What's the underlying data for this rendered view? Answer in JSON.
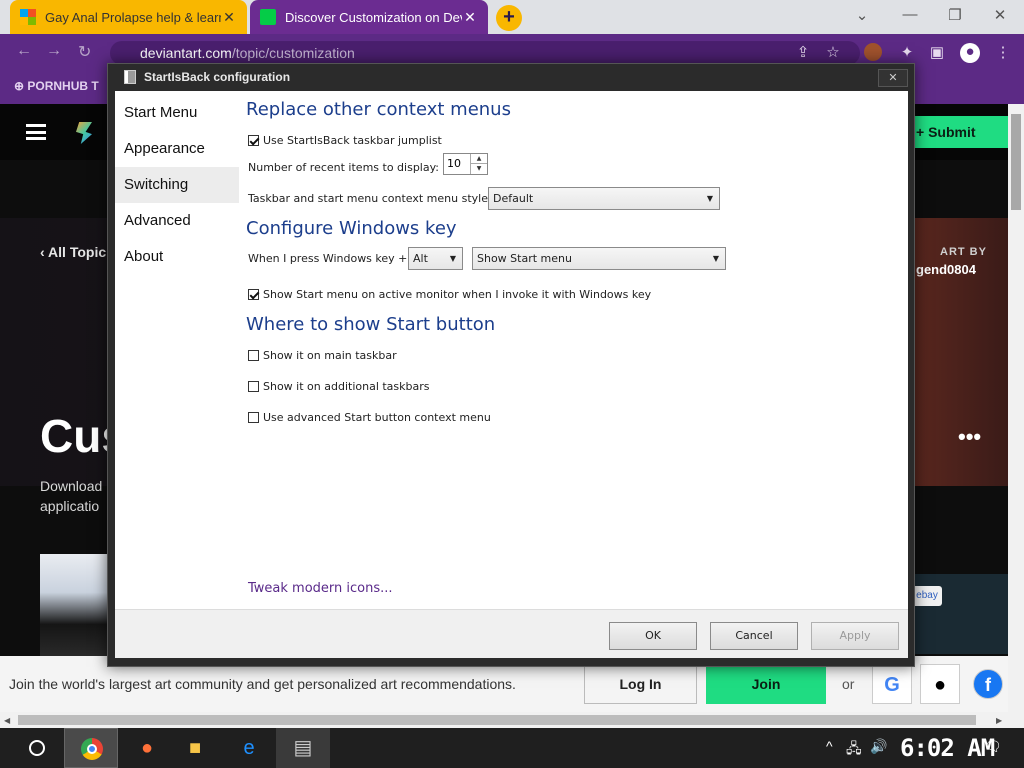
{
  "browser": {
    "tabs": [
      {
        "title": "Gay Anal Prolapse help & learni",
        "close": "✕"
      },
      {
        "title": "Discover Customization on Devi",
        "close": "✕"
      }
    ],
    "new_tab": "+",
    "window_controls": {
      "minimize": "⌄",
      "restore": "—",
      "maximize": "❐",
      "close": "✕"
    },
    "nav": {
      "back": "←",
      "forward": "→",
      "reload": "↻"
    },
    "url": {
      "host": "deviantart.com",
      "path": "/topic/customization"
    },
    "bookmark_label": "PORNHUB T"
  },
  "page": {
    "submit_label": "Submit",
    "all_topics": "All Topic",
    "art_by_label": "ART BY",
    "art_by_user": "gend0804",
    "heading_partial": "Cus",
    "download_text_1": "Download",
    "download_text_2": "applicatio",
    "ebay_label": "ebay",
    "more_dots": "•••"
  },
  "join_bar": {
    "message": "Join the world's largest art community and get personalized art recommendations.",
    "login": "Log In",
    "join": "Join",
    "or": "or",
    "social": [
      "G",
      "",
      "f"
    ]
  },
  "dialog": {
    "title": "StartIsBack configuration",
    "close": "✕",
    "sidebar": [
      "Start Menu",
      "Appearance",
      "Switching",
      "Advanced",
      "About"
    ],
    "active_sidebar": "Switching",
    "sections": {
      "context_menus": {
        "heading": "Replace other context menus",
        "jumplist_label": "Use StartIsBack taskbar jumplist",
        "jumplist_checked": true,
        "recent_label": "Number of recent items to display:",
        "recent_value": "10",
        "style_label": "Taskbar and start menu context menu style",
        "style_value": "Default"
      },
      "windows_key": {
        "heading": "Configure Windows key",
        "press_label": "When I press Windows key +",
        "modifier_value": "Alt",
        "action_value": "Show Start menu",
        "active_monitor_label": "Show Start menu on active monitor when I invoke it with Windows key",
        "active_monitor_checked": true
      },
      "start_button": {
        "heading": "Where to show Start button",
        "main_taskbar_label": "Show it on main taskbar",
        "additional_taskbars_label": "Show it on additional taskbars",
        "advanced_context_label": "Use advanced Start button context menu"
      }
    },
    "tweak_link": "Tweak modern icons...",
    "buttons": {
      "ok": "OK",
      "cancel": "Cancel",
      "apply": "Apply"
    }
  },
  "taskbar": {
    "clock": "6:02 AM",
    "tray_icons": [
      "^",
      "🖧",
      "🔊"
    ],
    "notifications_icon": "🗨"
  },
  "colors": {
    "browser_purple": "#5c2a85",
    "tab_yellow": "#f9b700",
    "da_green": "#1fdc82",
    "section_heading": "#1c3e8c",
    "link_purple": "#5a2a8a"
  }
}
